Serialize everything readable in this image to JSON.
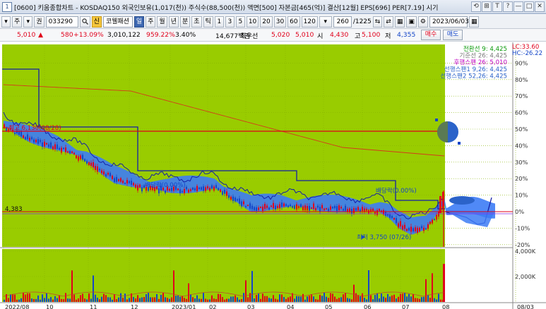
{
  "titlebar": {
    "icon": "1",
    "text": "[0600] 키움종합차트 - KOSDAQ150 외국인보유(1,017(천)) 주식수(88,500(천)) 액면[500] 자본금[465(억)] 결산[12월] EPS[696] PER[7.19] 시기",
    "buttons": [
      "⟲",
      "⊞",
      "T",
      "?",
      "—",
      "□",
      "✕"
    ]
  },
  "toolbar": {
    "items": [
      "▾",
      "주",
      "▾",
      "권"
    ],
    "code": "033290",
    "search_icon": "magnifier-icon",
    "stock_name_prefix": "신",
    "stock_name": "코웰패션",
    "periods": [
      "일",
      "주",
      "월",
      "년",
      "분",
      "초",
      "틱"
    ],
    "minute_steps": [
      "1",
      "3",
      "5",
      "10",
      "20",
      "30",
      "60",
      "120"
    ],
    "count": "260",
    "count_total": "/1225",
    "date": "2023/06/03",
    "calendar_icon": "calendar-icon"
  },
  "pricebar": {
    "price": "5,010",
    "change": "580",
    "change_pct": "+13.09%",
    "volume": "3,010,122",
    "volume_ratio": "959.22%",
    "turnover": "3.40%",
    "amount": "14,677백만",
    "best_ask_label": "최우선",
    "best_ask": "5,020",
    "best_bid": "5,010",
    "open_label": "시",
    "open": "4,430",
    "high_label": "고",
    "high": "5,100",
    "low_label": "저",
    "low": "4,355",
    "buy_label": "매수",
    "sell_label": "매도"
  },
  "chart": {
    "top_right_values": [
      "LC:33.60",
      "HC:-26.22"
    ],
    "legend": [
      {
        "text": "전환선 9: 4,425",
        "color": "#0a9a0a"
      },
      {
        "text": "기준선 26: 4,425",
        "color": "#7a7a7a"
      },
      {
        "text": "후행스팬 26: 5,010",
        "color": "#c000c0"
      },
      {
        "text": "선행스팬1 9,26: 4,425",
        "color": "#2b63c9"
      },
      {
        "text": "선행스팬2 52,26: 4,425",
        "color": "#2b63c9"
      }
    ],
    "annotations": {
      "high": "최고 6,130(08/28)",
      "low": "최저 3,750 (07/26)",
      "dividend1": "배당락(0.00%)",
      "dividend2": "배당락(0.00%)",
      "left_price": "4,383"
    },
    "price_axis_labels": [
      "90%",
      "80%",
      "70%",
      "60%",
      "50%",
      "40%",
      "30%",
      "20%",
      "10%",
      "0%",
      "-10%",
      "-20%"
    ],
    "volume_axis_labels": [
      "4,000K",
      "2,000K"
    ],
    "date_labels": [
      "2022/08",
      "10",
      "11",
      "12",
      "2023/01",
      "02",
      "03",
      "04",
      "05",
      "06",
      "07",
      "08",
      "08/03"
    ],
    "colors": {
      "background": "#99cc00",
      "future_area": "#ffffff",
      "cloud": "#3d7cf5",
      "up_candle": "#e0001b",
      "down_candle": "#1446c8",
      "line_blue": "#1520a6",
      "line_red": "#d43b1b"
    }
  }
}
